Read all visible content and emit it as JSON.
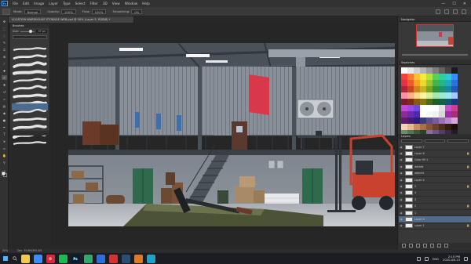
{
  "app": {
    "logo": "Ps",
    "menu": [
      "File",
      "Edit",
      "Image",
      "Layer",
      "Type",
      "Select",
      "Filter",
      "3D",
      "View",
      "Window",
      "Help"
    ],
    "window_controls": [
      "—",
      "☐",
      "✕"
    ]
  },
  "options_bar": {
    "mode_label": "Mode:",
    "mode_value": "Normal",
    "opacity_label": "Opacity:",
    "opacity_value": "100%",
    "flow_label": "Flow:",
    "flow_value": "100%",
    "smoothing_label": "Smoothing:",
    "smoothing_value": "0%"
  },
  "document": {
    "tab_title": "LOCATION WAREHOUSE STORAGE WEB.psd @ 50% (Layer 5, RGB/8) *"
  },
  "brushes_panel": {
    "title": "Brushes",
    "size_label": "Size:",
    "size_value": "37 px"
  },
  "navigator": {
    "title": "Navigator"
  },
  "swatches": {
    "title": "Swatches",
    "colors": [
      "#ffffff",
      "#e8e8e8",
      "#cfcfcf",
      "#b5b5b5",
      "#9a9a9a",
      "#7e7e7e",
      "#626262",
      "#444444",
      "#1a1a1a",
      "#ff3b3b",
      "#ff7a2f",
      "#ffc22e",
      "#f4ec3a",
      "#b6e23c",
      "#55d15a",
      "#2fcf9b",
      "#2fc6d6",
      "#3b8cff",
      "#e2324a",
      "#f0592a",
      "#f5a524",
      "#e9d92c",
      "#97c834",
      "#3fb54a",
      "#25b58a",
      "#22a7c3",
      "#2f6fe0",
      "#b0243b",
      "#c7461f",
      "#cf861a",
      "#c6b321",
      "#78a327",
      "#2f923a",
      "#1c9170",
      "#1a88a0",
      "#2755b8",
      "#ff8fa3",
      "#ffb08a",
      "#ffd98a",
      "#fff3a0",
      "#d6f0a0",
      "#a8e8ad",
      "#99ecd2",
      "#9fe6f0",
      "#a6c7ff",
      "#7a1b2e",
      "#7f2d13",
      "#8a5a10",
      "#857812",
      "#4d6b18",
      "#1e6127",
      "#13604b",
      "#115a6b",
      "#1a3a80",
      "#c44ad6",
      "#9b4ae0",
      "#6a4ae0",
      "#ffffff",
      "#ffffff",
      "#ffffff",
      "#e0e0e0",
      "#c94fd0",
      "#d23c8f",
      "#8f2a9e",
      "#6c2ab0",
      "#4a2ab0",
      "#fdfdfd",
      "#f7f7f7",
      "#f0f0f0",
      "#d8d8d8",
      "#a12fa3",
      "#a52d70",
      "#5e1c69",
      "#461c78",
      "#311c78",
      "#3b3b7a",
      "#5d4e8c",
      "#7b5aa0",
      "#9c70b5",
      "#b98ac9",
      "#d6a6dc",
      "#f3d5b5",
      "#e6b98f",
      "#c98f64",
      "#a86f4a",
      "#87553a",
      "#68412c",
      "#4a2e20",
      "#2f1d14",
      "#1a100a",
      "#6b8e6b",
      "#557355",
      "#3e583e",
      "#2b402b",
      "#8d6f9e",
      "#6f5480",
      "#523c61",
      "#3a2a45",
      "#24192b"
    ]
  },
  "layers": {
    "title": "Layers",
    "items": [
      {
        "name": "Layer 7",
        "visible": true,
        "locked": false
      },
      {
        "name": "Layer 6",
        "visible": true,
        "locked": true
      },
      {
        "name": "Color fill 1",
        "visible": true,
        "locked": false
      },
      {
        "name": "details",
        "visible": true,
        "locked": true
      },
      {
        "name": "objects",
        "visible": true,
        "locked": false
      },
      {
        "name": "Layer 4",
        "visible": true,
        "locked": false
      },
      {
        "name": "5",
        "visible": true,
        "locked": true
      },
      {
        "name": "4",
        "visible": true,
        "locked": false
      },
      {
        "name": "3",
        "visible": true,
        "locked": false
      },
      {
        "name": "2",
        "visible": true,
        "locked": true
      },
      {
        "name": "1",
        "visible": true,
        "locked": false
      },
      {
        "name": "Layer 5",
        "visible": true,
        "locked": false,
        "selected": true
      },
      {
        "name": "Layer 1",
        "visible": true,
        "locked": true
      }
    ]
  },
  "status": {
    "zoom": "50%",
    "doc_size": "Doc: 35,6M/395,4M"
  },
  "taskbar": {
    "apps": [
      {
        "name": "file-explorer",
        "label": "",
        "color": "#f2c94c"
      },
      {
        "name": "chrome",
        "label": "",
        "color": "#3b8cff"
      },
      {
        "name": "opera",
        "label": "O",
        "color": "#e0243b"
      },
      {
        "name": "spotify",
        "label": "",
        "color": "#1db954"
      },
      {
        "name": "photoshop",
        "label": "Ps",
        "color": "#001e36"
      },
      {
        "name": "app-green",
        "label": "",
        "color": "#2fa86a"
      },
      {
        "name": "app-blue",
        "label": "",
        "color": "#2a6fdb"
      },
      {
        "name": "app-red",
        "label": "",
        "color": "#d83030"
      },
      {
        "name": "app-steam",
        "label": "",
        "color": "#2b4e75"
      },
      {
        "name": "app-orange",
        "label": "",
        "color": "#e07a20"
      },
      {
        "name": "app-cyan",
        "label": "",
        "color": "#1aa3c7"
      }
    ],
    "language": "ENG",
    "time": "2:15 PM",
    "date": "2020-08-13"
  },
  "colors": {
    "accent": "#31a8ff",
    "selection": "#536b88",
    "canvas_bg": "#262626"
  }
}
